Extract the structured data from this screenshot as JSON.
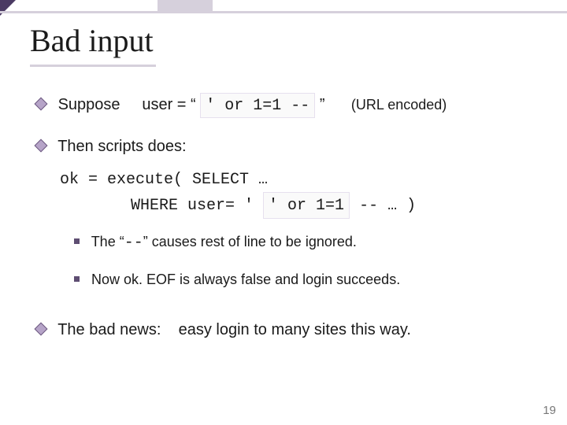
{
  "title": "Bad input",
  "line1": {
    "lead": "Suppose",
    "user_eq": "user = “",
    "box": "' or 1=1 --",
    "close_q": "”",
    "note": "(URL encoded)"
  },
  "line2": {
    "lead": "Then scripts does:",
    "code1": "ok = execute( SELECT …",
    "code2a": "WHERE user= '",
    "code2_box": "' or 1=1 ",
    "code2b": " -- … )"
  },
  "sub1": {
    "a": "The  “",
    "b": "--",
    "c": "”  causes rest of line to be ignored."
  },
  "sub2": {
    "a": "Now  ok. EOF  is always false and login succeeds."
  },
  "line3": {
    "lead": "The bad news:    easy login to many sites this way."
  },
  "page": "19"
}
